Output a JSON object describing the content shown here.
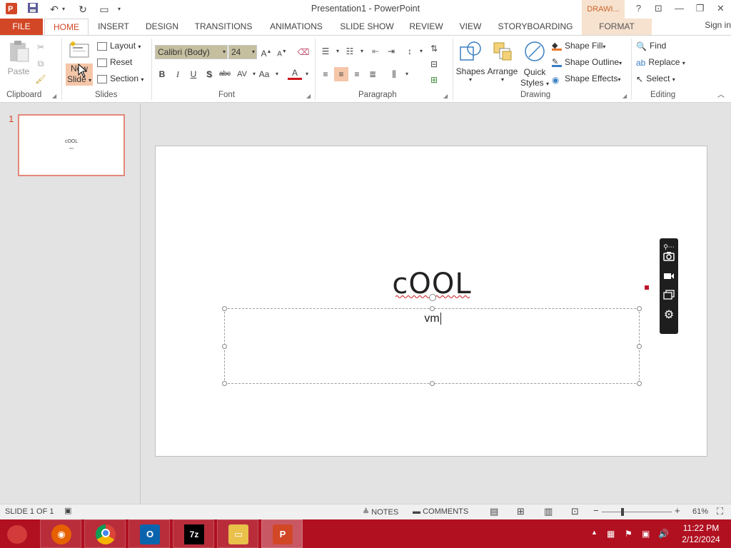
{
  "titlebar": {
    "title": "Presentation1 - PowerPoint",
    "contextual_group": "DRAWI...",
    "help": "?",
    "controls": {
      "restore_ribbon": "⊡",
      "minimize": "—",
      "maximize": "❐",
      "close": "✕"
    }
  },
  "tabs": {
    "file": "FILE",
    "home": "HOME",
    "insert": "INSERT",
    "design": "DESIGN",
    "transitions": "TRANSITIONS",
    "animations": "ANIMATIONS",
    "slideshow": "SLIDE SHOW",
    "review": "REVIEW",
    "view": "VIEW",
    "storyboarding": "STORYBOARDING",
    "format": "FORMAT",
    "signin": "Sign in"
  },
  "ribbon": {
    "clipboard": {
      "label": "Clipboard",
      "paste": "Paste"
    },
    "slides": {
      "label": "Slides",
      "new_slide_line1": "New",
      "new_slide_line2": "Slide",
      "layout": "Layout",
      "reset": "Reset",
      "section": "Section"
    },
    "font": {
      "label": "Font",
      "font_name": "Calibri (Body)",
      "font_size": "24",
      "bold": "B",
      "italic": "I",
      "underline": "U",
      "shadow": "S",
      "strike": "abc",
      "spacing": "AV",
      "case": "Aa",
      "color": "A"
    },
    "paragraph": {
      "label": "Paragraph"
    },
    "drawing": {
      "label": "Drawing",
      "shapes": "Shapes",
      "arrange": "Arrange",
      "quick_styles_line1": "Quick",
      "quick_styles_line2": "Styles",
      "shape_fill": "Shape Fill",
      "shape_outline": "Shape Outline",
      "shape_effects": "Shape Effects"
    },
    "editing": {
      "label": "Editing",
      "find": "Find",
      "replace": "Replace",
      "select": "Select"
    }
  },
  "thumbnails": {
    "number": "1",
    "title": "cOOL",
    "subtitle": "vm"
  },
  "slide": {
    "title": "cOOL",
    "subtitle": "vm"
  },
  "statusbar": {
    "slide_info": "SLIDE 1 OF 1",
    "notes": "NOTES",
    "comments": "COMMENTS",
    "zoom": "61%"
  },
  "taskbar": {
    "time": "11:22 PM",
    "date": "2/12/2024",
    "apps": [
      "firefox",
      "chrome",
      "outlook",
      "7zip",
      "file-explorer",
      "powerpoint"
    ]
  },
  "colors": {
    "accent": "#d24726",
    "taskbar": "#b01020",
    "contextual_tab": "#f7e2cf"
  }
}
